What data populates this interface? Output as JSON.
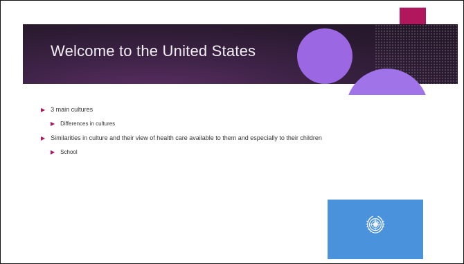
{
  "slide": {
    "title": "Welcome to the United States",
    "bullets": [
      {
        "level": 1,
        "text": "3 main cultures"
      },
      {
        "level": 2,
        "text": "Differences in cultures"
      },
      {
        "level": 1,
        "text": "Similarities in culture and their view of health care available to them and especially to their children"
      },
      {
        "level": 2,
        "text": "School"
      }
    ],
    "image": {
      "name": "un-flag",
      "icon": "un-emblem-icon"
    }
  },
  "colors": {
    "banner": "#2a1a30",
    "accent": "#b0175c",
    "circle": "#9b67e3",
    "flag": "#4b92dd"
  }
}
